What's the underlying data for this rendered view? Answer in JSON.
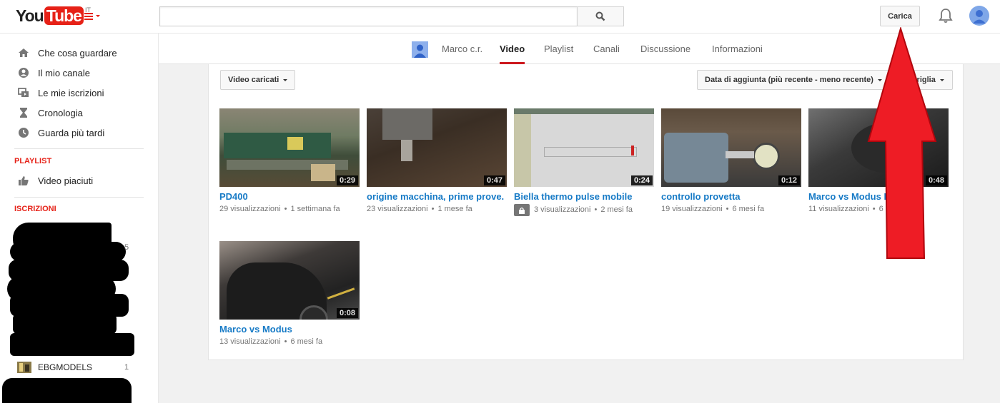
{
  "header": {
    "logo_you": "You",
    "logo_tube": "Tube",
    "logo_country": "IT",
    "search_placeholder": "",
    "upload_label": "Carica"
  },
  "sidebar": {
    "items": [
      {
        "label": "Che cosa guardare",
        "icon": "home-icon"
      },
      {
        "label": "Il mio canale",
        "icon": "person-icon"
      },
      {
        "label": "Le mie iscrizioni",
        "icon": "subscriptions-icon"
      },
      {
        "label": "Cronologia",
        "icon": "hourglass-icon"
      },
      {
        "label": "Guarda più tardi",
        "icon": "clock-icon"
      }
    ],
    "playlist_heading": "PLAYLIST",
    "playlist_items": [
      {
        "label": "Video piaciuti",
        "icon": "thumbs-up-icon"
      }
    ],
    "subscriptions_heading": "ISCRIZIONI",
    "subscriptions": [
      {
        "label": "",
        "count": "5"
      },
      {
        "label": "EBGMODELS",
        "count": "1"
      }
    ]
  },
  "channel_nav": {
    "channel_name": "Marco c.r.",
    "tabs": [
      "Video",
      "Playlist",
      "Canali",
      "Discussione",
      "Informazioni"
    ],
    "active_tab": "Video"
  },
  "toolbar": {
    "filter_label": "Video caricati",
    "sort_label": "Data di aggiunta (più recente - meno recente)",
    "view_label": "Griglia"
  },
  "videos": [
    {
      "title": "PD400",
      "duration": "0:29",
      "views": "29 visualizzazioni",
      "age": "1 settimana fa",
      "private": false
    },
    {
      "title": "origine macchina, prime prove.",
      "duration": "0:47",
      "views": "23 visualizzazioni",
      "age": "1 mese fa",
      "private": false
    },
    {
      "title": "Biella thermo pulse mobile",
      "duration": "0:24",
      "views": "3 visualizzazioni",
      "age": "2 mesi fa",
      "private": true
    },
    {
      "title": "controllo provetta",
      "duration": "0:12",
      "views": "19 visualizzazioni",
      "age": "6 mesi fa",
      "private": false
    },
    {
      "title": "Marco vs Modus I",
      "duration": "0:48",
      "views": "11 visualizzazioni",
      "age": "6 mesi fa",
      "private": false
    },
    {
      "title": "Marco vs Modus",
      "duration": "0:08",
      "views": "13 visualizzazioni",
      "age": "6 mesi fa",
      "private": false
    }
  ],
  "colors": {
    "brand_red": "#e62117",
    "link_blue": "#167ac6",
    "annotation_arrow": "#ee1c25"
  }
}
